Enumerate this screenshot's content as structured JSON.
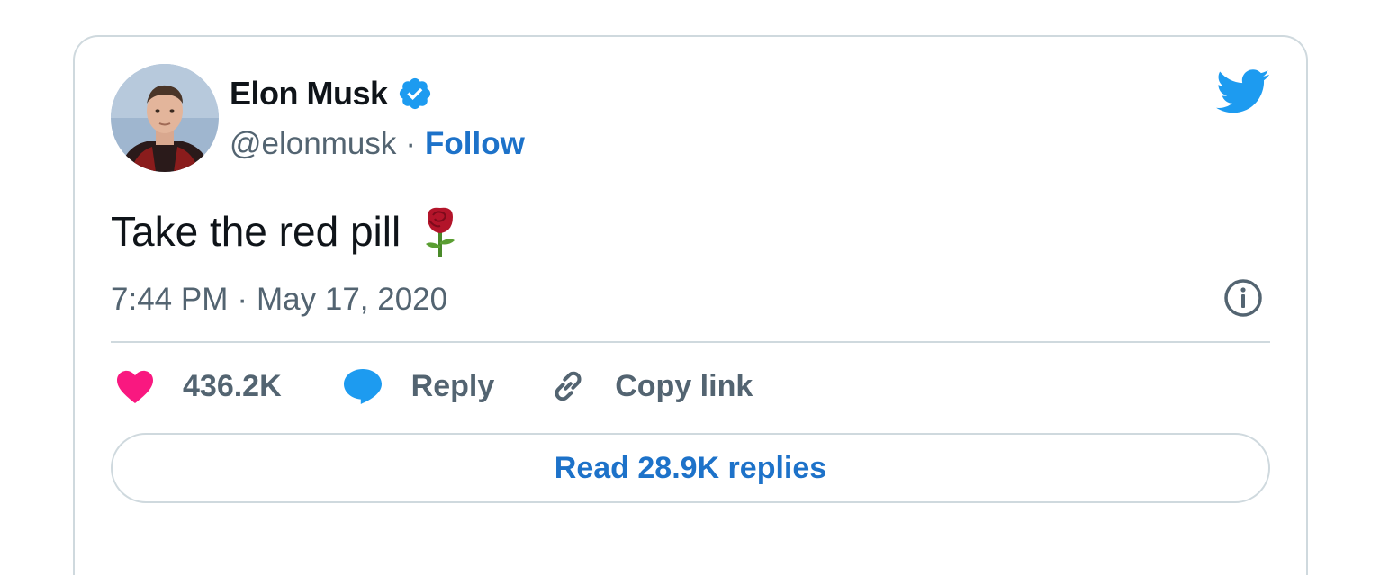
{
  "author": {
    "display_name": "Elon Musk",
    "handle": "@elonmusk",
    "separator": "·",
    "follow_label": "Follow",
    "avatar_icon": "profile-photo",
    "verified_icon": "verified-badge-icon"
  },
  "tweet": {
    "text": "Take the red pill",
    "emoji_icon": "rose-icon",
    "time": "7:44 PM",
    "date_separator": "·",
    "date": "May 17, 2020"
  },
  "actions": {
    "likes_count": "436.2K",
    "reply_label": "Reply",
    "copy_link_label": "Copy link"
  },
  "footer": {
    "read_replies_label": "Read 28.9K replies"
  },
  "colors": {
    "twitter_blue": "#1d9bf0",
    "link_blue": "#1d72c9",
    "like_pink": "#f91880",
    "secondary_text": "#536471",
    "border": "#cfd9de"
  }
}
